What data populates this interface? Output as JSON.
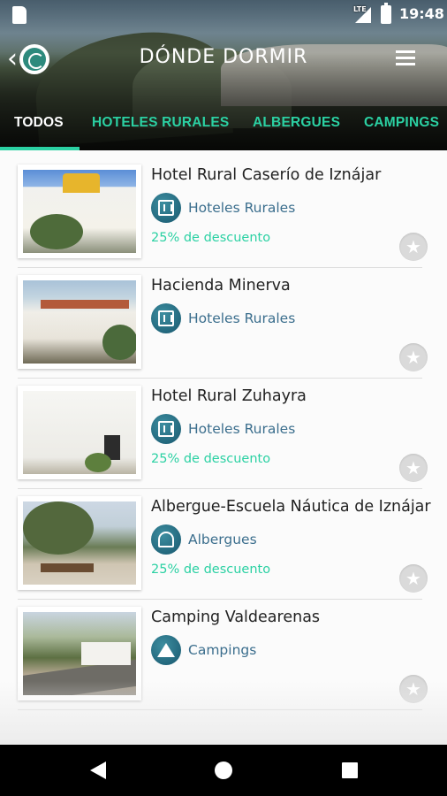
{
  "status_bar": {
    "network": "LTE",
    "time": "19:48"
  },
  "header": {
    "title": "DÓNDE DORMIR"
  },
  "tabs": [
    {
      "label": "TODOS",
      "active": true
    },
    {
      "label": "HOTELES RURALES",
      "active": false
    },
    {
      "label": "ALBERGUES",
      "active": false
    },
    {
      "label": "CAMPINGS",
      "active": false
    }
  ],
  "colors": {
    "accent": "#2bd1a3",
    "category_text": "#3b6e8d",
    "category_icon": "#1f6278"
  },
  "items": [
    {
      "title": "Hotel Rural Caserío de Iznájar",
      "category": "Hoteles Rurales",
      "category_icon": "hotel-icon",
      "discount": "25% de descuento"
    },
    {
      "title": "Hacienda Minerva",
      "category": "Hoteles Rurales",
      "category_icon": "hotel-icon",
      "discount": ""
    },
    {
      "title": "Hotel Rural Zuhayra",
      "category": "Hoteles Rurales",
      "category_icon": "hotel-icon",
      "discount": "25% de descuento"
    },
    {
      "title": "Albergue-Escuela Náutica de Iznájar",
      "category": "Albergues",
      "category_icon": "hostel-icon",
      "discount": "25% de descuento"
    },
    {
      "title": "Camping Valdearenas",
      "category": "Campings",
      "category_icon": "tent-icon",
      "discount": ""
    }
  ]
}
